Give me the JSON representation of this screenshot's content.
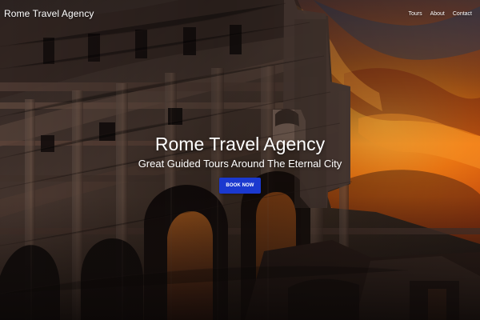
{
  "header": {
    "brand": "Rome Travel Agency",
    "nav": [
      {
        "label": "Tours"
      },
      {
        "label": "About"
      },
      {
        "label": "Contact"
      }
    ]
  },
  "hero": {
    "title": "Rome Travel Agency",
    "subtitle": "Great Guided Tours Around The Eternal City",
    "button_label": "BOOK NOW",
    "image_subject": "Colosseum at sunset"
  },
  "colors": {
    "button": "#1b39cf",
    "text": "#ffffff",
    "sky_orange": "#e56d14",
    "stone": "#3d302b"
  }
}
